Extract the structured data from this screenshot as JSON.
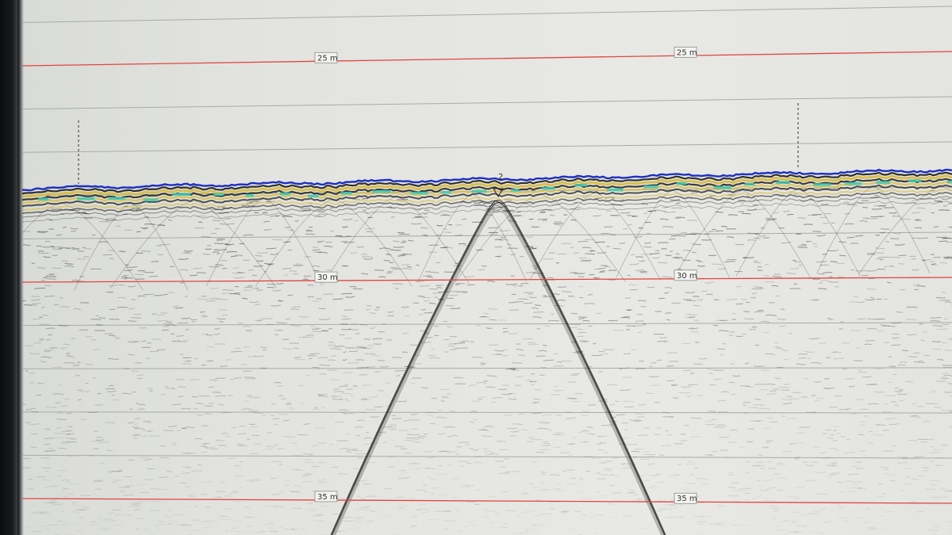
{
  "viewer": {
    "depth_unit": "m",
    "depth_markers": [
      {
        "depth": 25,
        "label": "25 m"
      },
      {
        "depth": 30,
        "label": "30 m"
      },
      {
        "depth": 35,
        "label": "35 m"
      }
    ],
    "seabed_pick_label": "2",
    "colors": {
      "depth_line": "#e0463f",
      "gridline": "#a9aba8",
      "seabed_trace": "#1d2fc4",
      "reflection_amber": "#d6b93e",
      "reflection_cyan": "#3fc7b0",
      "trace_ink": "#1a1a1a"
    }
  }
}
